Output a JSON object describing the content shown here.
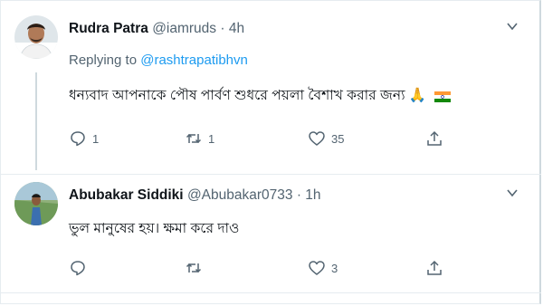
{
  "tweets": [
    {
      "name": "Rudra Patra",
      "handle": "@iamruds",
      "time": "· 4h",
      "replying_prefix": "Replying to ",
      "replying_to": "@rashtrapatibhvn",
      "text": "ধন্যবাদ আপনাকে পৌষ পার্বণ শুধরে পয়লা বৈশাখ করার জন্য 🙏",
      "reply_count": "1",
      "retweet_count": "1",
      "like_count": "35"
    },
    {
      "name": "Abubakar Siddiki",
      "handle": "@Abubakar0733",
      "time": "· 1h",
      "text": "ভুল মানুষের হয়। ক্ষমা করে দাও",
      "reply_count": "",
      "retweet_count": "",
      "like_count": "3"
    }
  ],
  "colors": {
    "link": "#1d9bf0",
    "secondary": "#536471",
    "text": "#0f1419",
    "border": "#e6ecf0"
  }
}
